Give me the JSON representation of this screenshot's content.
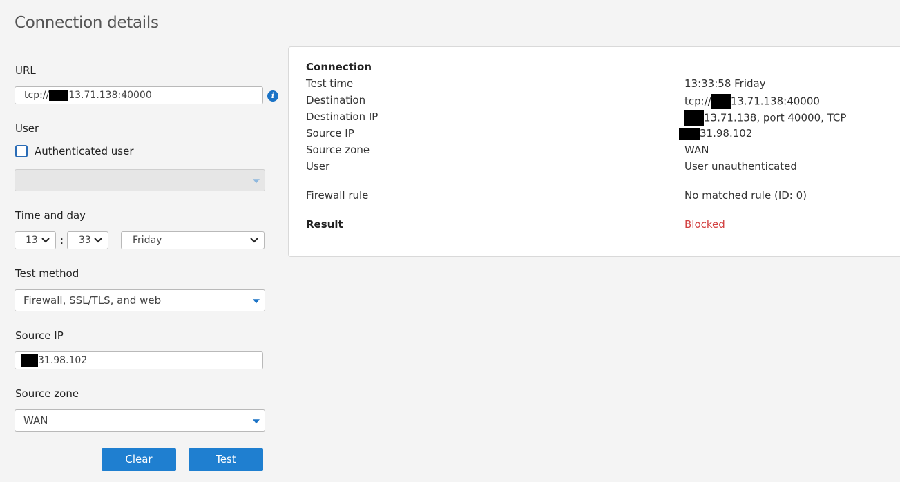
{
  "page": {
    "title": "Connection details"
  },
  "form": {
    "url": {
      "label": "URL",
      "value": "13.71.138:40000",
      "prefix": "tcp://"
    },
    "user": {
      "label": "User",
      "checkbox_label": "Authenticated user",
      "checked": false,
      "select_value": ""
    },
    "time": {
      "label": "Time and day",
      "hour": "13",
      "minute": "33",
      "separator": ":",
      "day": "Friday"
    },
    "method": {
      "label": "Test method",
      "value": "Firewall, SSL/TLS, and web"
    },
    "source_ip": {
      "label": "Source IP",
      "value": "31.98.102"
    },
    "source_zone": {
      "label": "Source zone",
      "value": "WAN"
    },
    "buttons": {
      "clear": "Clear",
      "test": "Test"
    }
  },
  "result": {
    "heading": "Connection",
    "rows": [
      {
        "label": "Test time",
        "value": "13:33:58 Friday"
      },
      {
        "label": "Destination",
        "prefix": "tcp://",
        "value": "13.71.138:40000"
      },
      {
        "label": "Destination IP",
        "value": "13.71.138, port 40000, TCP"
      },
      {
        "label": "Source IP",
        "value": "31.98.102"
      },
      {
        "label": "Source zone",
        "value": "WAN"
      },
      {
        "label": "User",
        "value": "User unauthenticated"
      }
    ],
    "firewall_rule": {
      "label": "Firewall rule",
      "value": "No matched rule (ID: 0)"
    },
    "result": {
      "label": "Result",
      "value": "Blocked"
    }
  },
  "colors": {
    "accent": "#1f7fd0",
    "blocked": "#d24040"
  },
  "icons": [
    "info-icon",
    "dropdown-triangle-icon",
    "chevron-down-icon"
  ]
}
